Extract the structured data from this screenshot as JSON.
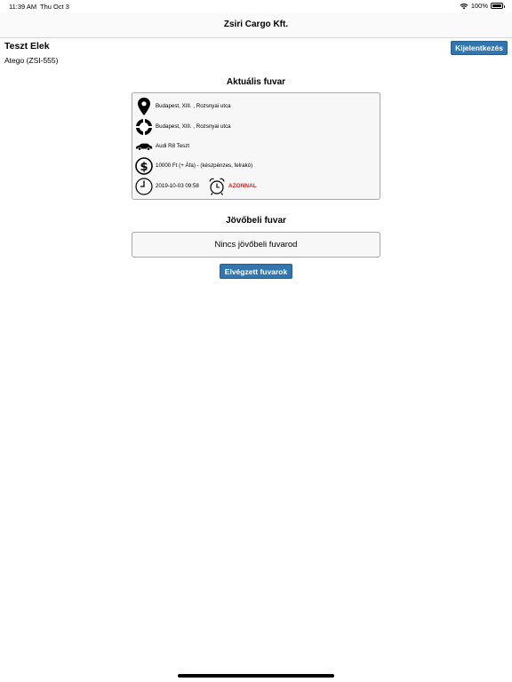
{
  "status_bar": {
    "time": "11:39 AM",
    "date": "Thu Oct 3",
    "battery": "100%",
    "wifi_icon": "wifi-icon",
    "battery_icon": "battery-icon"
  },
  "header": {
    "title": "Zsiri Cargo Kft."
  },
  "user": {
    "name": "Teszt Elek",
    "vehicle": "Atego (ZSI-555)",
    "logout_label": "Kijelentkezés"
  },
  "current": {
    "title": "Aktuális fuvar",
    "pickup": "Budapest, XIII. , Rozsnyai utca",
    "destination": "Budapest, XIII. , Rozsnyai utca",
    "car": "Audi R8 Teszt",
    "price": "10000 Ft (+ Áfa) - (készpénzes, felrakó)",
    "datetime": "2019-10-03 09:58",
    "urgency": "AZONNAL",
    "urgency_color": "#d9201e"
  },
  "future": {
    "title": "Jövőbeli fuvar",
    "empty_text": "Nincs jövőbeli fuvarod"
  },
  "completed_button_label": "Elvégzett fuvarok",
  "accent_color": "#3276b1"
}
